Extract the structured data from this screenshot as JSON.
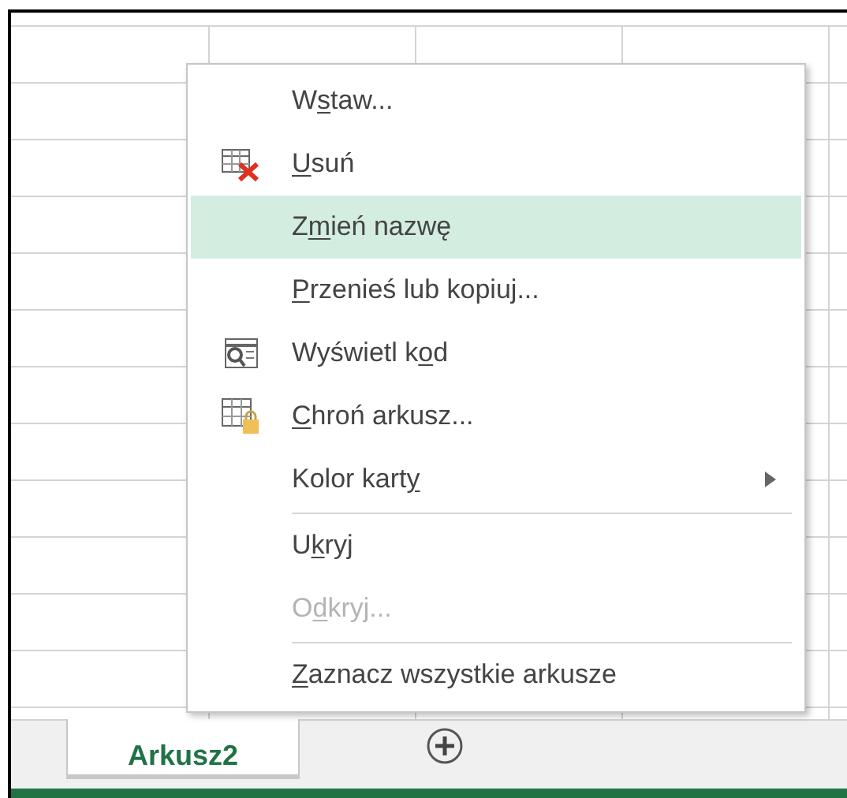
{
  "context_menu": {
    "items": [
      {
        "kind": "plain",
        "before": "W",
        "key": "s",
        "after": "taw...",
        "selected": false,
        "disabled": false
      },
      {
        "kind": "delete",
        "key": "U",
        "after": "suń",
        "selected": false,
        "disabled": false
      },
      {
        "kind": "plain",
        "before": "Z",
        "key": "m",
        "after": "ień nazwę",
        "selected": true,
        "disabled": false
      },
      {
        "kind": "plain",
        "key": "P",
        "after": "rzenieś lub kopiuj...",
        "selected": false,
        "disabled": false
      },
      {
        "kind": "code",
        "before": "Wyświetl k",
        "key": "o",
        "after": "d",
        "selected": false,
        "disabled": false
      },
      {
        "kind": "protect",
        "key": "C",
        "after": "hroń arkusz...",
        "selected": false,
        "disabled": false
      },
      {
        "kind": "submenu",
        "before": "Kolor kart",
        "key": "y",
        "selected": false,
        "disabled": false
      },
      {
        "kind": "separator"
      },
      {
        "kind": "plain",
        "before": "U",
        "key": "k",
        "after": "ryj",
        "selected": false,
        "disabled": false
      },
      {
        "kind": "plain",
        "before": "O",
        "key": "d",
        "after": "kryj...",
        "selected": false,
        "disabled": true
      },
      {
        "kind": "separator"
      },
      {
        "kind": "plain",
        "key": "Z",
        "after": "aznacz wszystkie arkusze",
        "selected": false,
        "disabled": false
      }
    ]
  },
  "sheet_tabs": [
    {
      "label": "Arkusz2",
      "selected": true
    }
  ]
}
